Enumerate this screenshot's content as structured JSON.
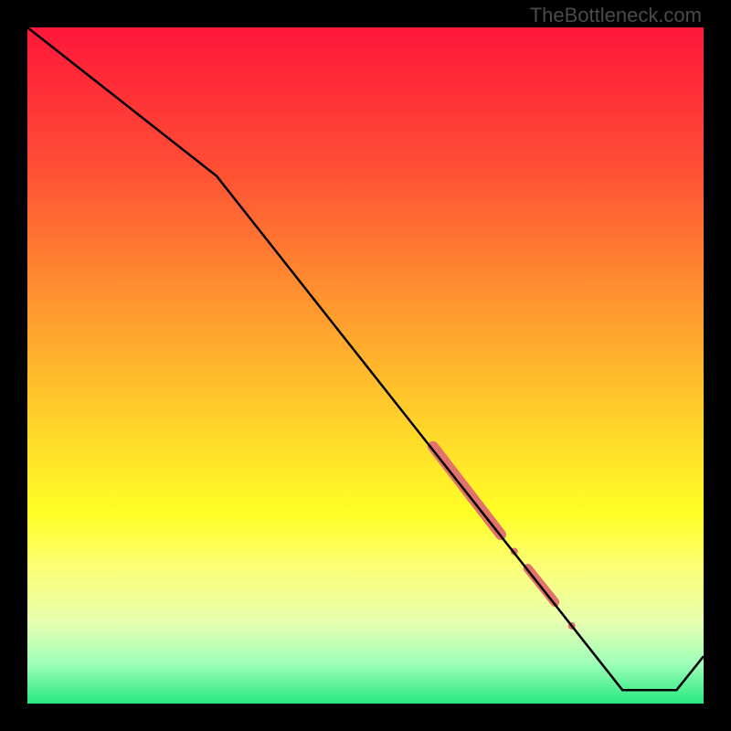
{
  "watermark": "TheBottleneck.com",
  "chart_data": {
    "type": "line",
    "title": "",
    "xlabel": "",
    "ylabel": "",
    "xlim": [
      0,
      100
    ],
    "ylim": [
      0,
      100
    ],
    "gradient_stops": [
      {
        "offset": 0,
        "color": "#ff173a"
      },
      {
        "offset": 20,
        "color": "#ff4c35"
      },
      {
        "offset": 40,
        "color": "#ff932f"
      },
      {
        "offset": 60,
        "color": "#ffd82a"
      },
      {
        "offset": 72,
        "color": "#ffff26"
      },
      {
        "offset": 80,
        "color": "#fcff78"
      },
      {
        "offset": 88,
        "color": "#e6ffb0"
      },
      {
        "offset": 94,
        "color": "#a0ffb8"
      },
      {
        "offset": 100,
        "color": "#27e87f"
      }
    ],
    "series": [
      {
        "name": "curve",
        "color": "#000000",
        "points": [
          {
            "x": 0,
            "y": 100
          },
          {
            "x": 28,
            "y": 78
          },
          {
            "x": 88,
            "y": 2
          },
          {
            "x": 96,
            "y": 2
          },
          {
            "x": 100,
            "y": 7
          }
        ]
      }
    ],
    "highlights": [
      {
        "name": "segment-1",
        "x1": 60,
        "y1": 38,
        "x2": 70,
        "y2": 25,
        "width": 12,
        "color": "#e2726c"
      },
      {
        "name": "dot-1",
        "cx": 72,
        "cy": 22.5,
        "r": 4,
        "color": "#e2726c"
      },
      {
        "name": "segment-2",
        "x1": 74,
        "y1": 20,
        "x2": 78,
        "y2": 15,
        "width": 10,
        "color": "#e2726c"
      },
      {
        "name": "dot-2",
        "cx": 80.5,
        "cy": 11.5,
        "r": 4,
        "color": "#e2726c"
      }
    ]
  }
}
